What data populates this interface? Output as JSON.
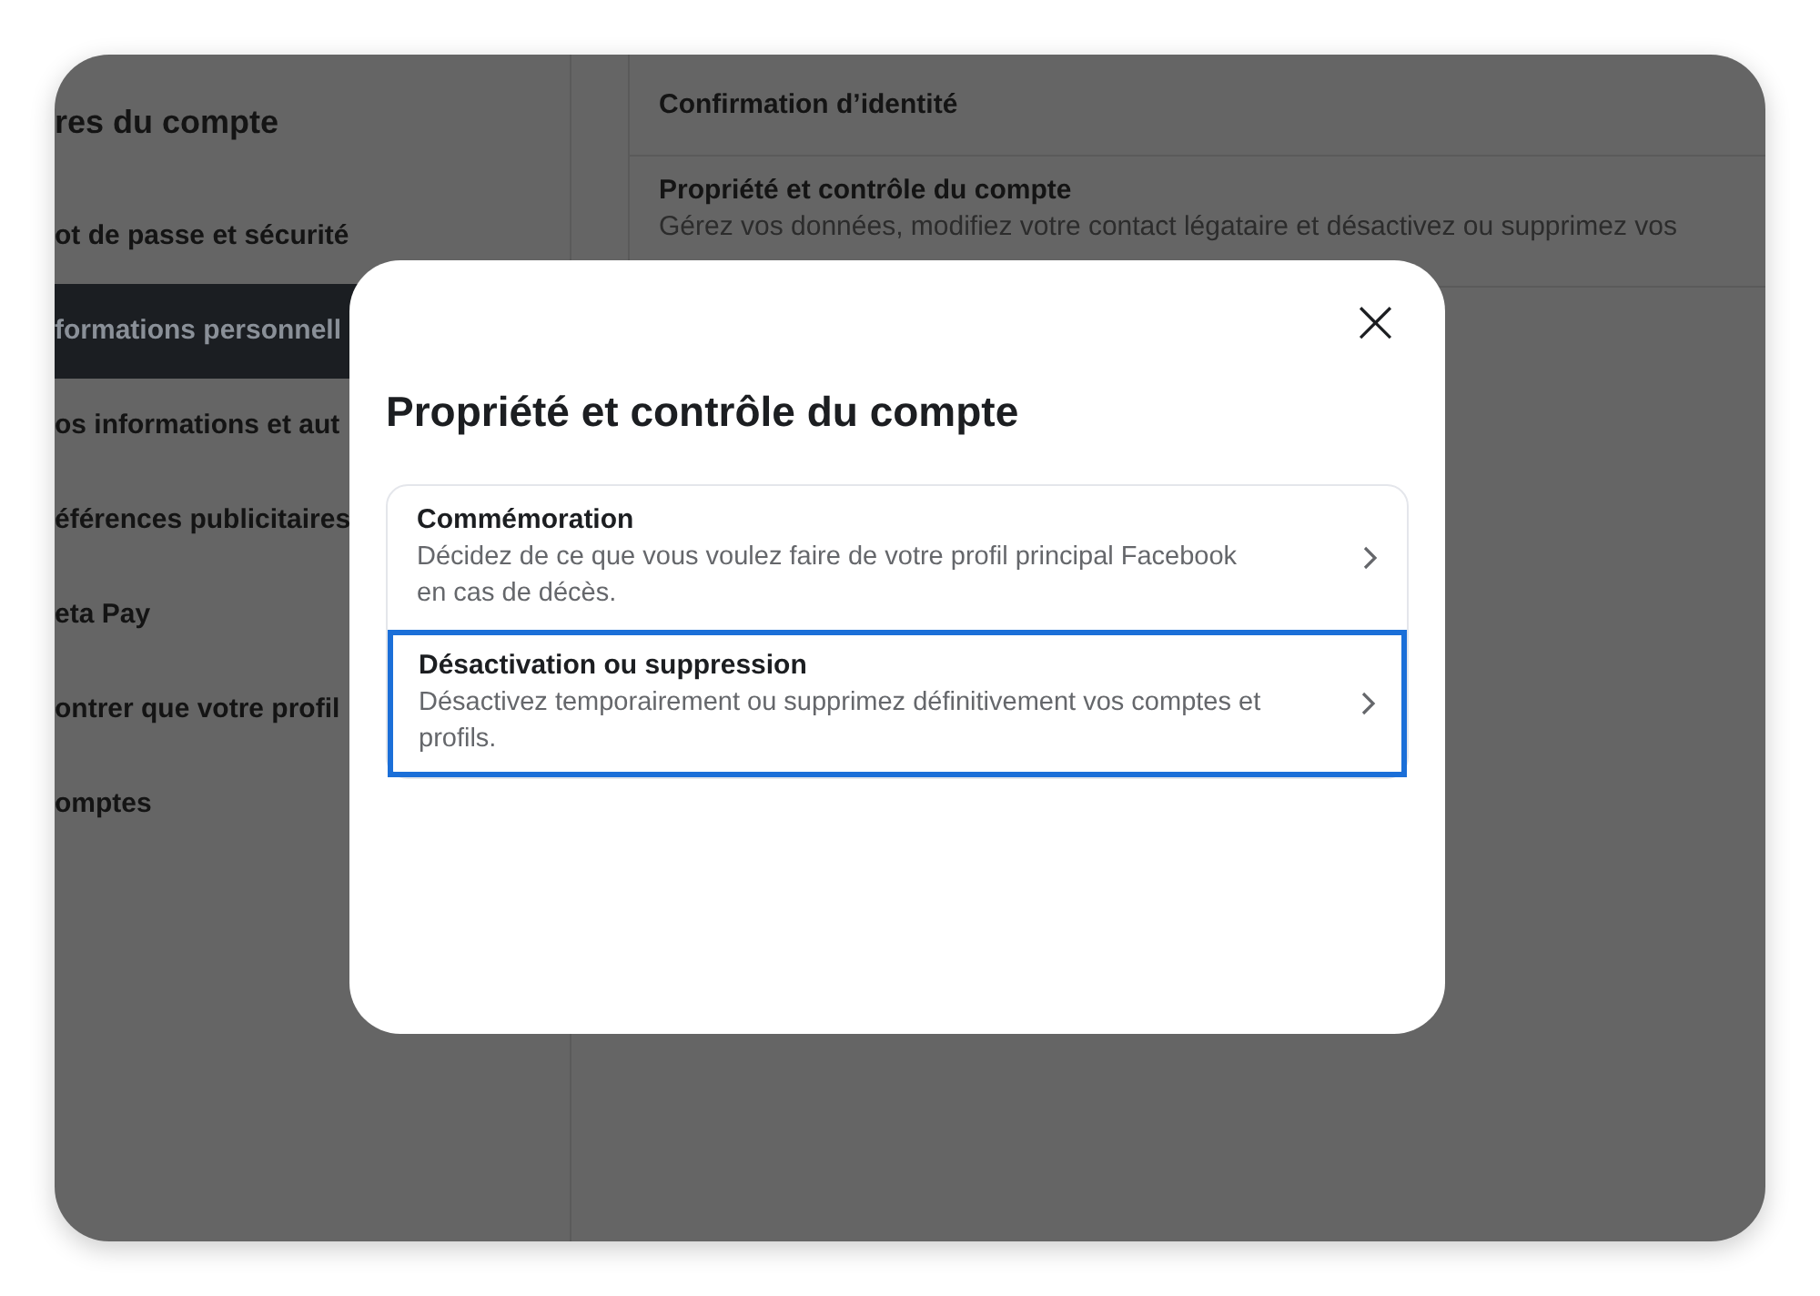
{
  "sidebar": {
    "title": "res du compte",
    "items": [
      {
        "label": "ot de passe et sécurité",
        "selected": false
      },
      {
        "label": "formations personnell",
        "selected": true
      },
      {
        "label": "os informations et aut",
        "selected": false
      },
      {
        "label": "éférences publicitaires",
        "selected": false
      },
      {
        "label": "eta Pay",
        "selected": false
      },
      {
        "label": "ontrer que votre profil",
        "selected": false
      },
      {
        "label": "omptes",
        "selected": false
      }
    ]
  },
  "settings": [
    {
      "title": "Confirmation d’identité"
    },
    {
      "title": "Propriété et contrôle du compte",
      "description": "Gérez vos données, modifiez votre contact légataire et désactivez ou supprimez vos"
    }
  ],
  "dialog": {
    "title": "Propriété et contrôle du compte",
    "close": "×",
    "options": [
      {
        "title": "Commémoration",
        "description": "Décidez de ce que vous voulez faire de votre profil principal Facebook en cas de décès.",
        "selected": false
      },
      {
        "title": "Désactivation ou suppression",
        "description": "Désactivez temporairement ou supprimez définitivement vos comptes et profils.",
        "selected": true
      }
    ]
  }
}
